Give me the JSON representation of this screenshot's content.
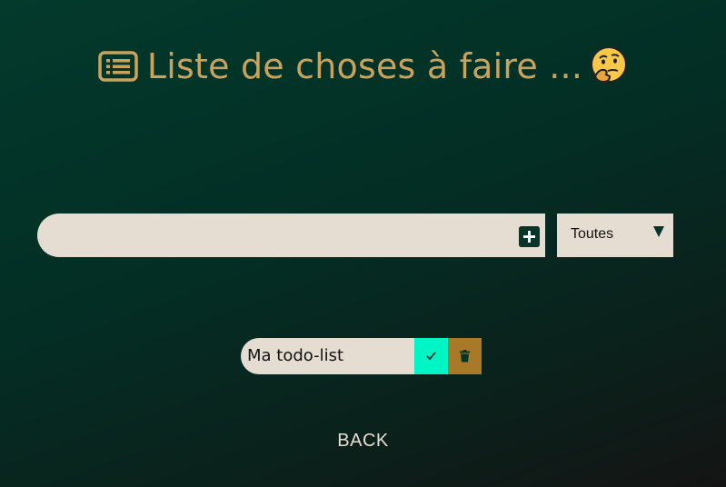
{
  "header": {
    "title": "Liste de choses à faire ...",
    "list_icon": "list-icon",
    "emoji_icon": "thinking-face-emoji",
    "accent_color": "#c9a35e"
  },
  "form": {
    "input_value": "",
    "add_icon": "plus-square-icon",
    "filter_selected": "Toutes",
    "filter_icon": "chevron-down-icon"
  },
  "todos": [
    {
      "text": "Ma todo-list",
      "complete_icon": "check-icon",
      "delete_icon": "trash-icon",
      "complete_color": "#00f5c4",
      "delete_color": "#a87a27"
    }
  ],
  "nav": {
    "back_label": "BACK"
  },
  "colors": {
    "background": "#033a2c",
    "surface": "#e5ddd2"
  }
}
